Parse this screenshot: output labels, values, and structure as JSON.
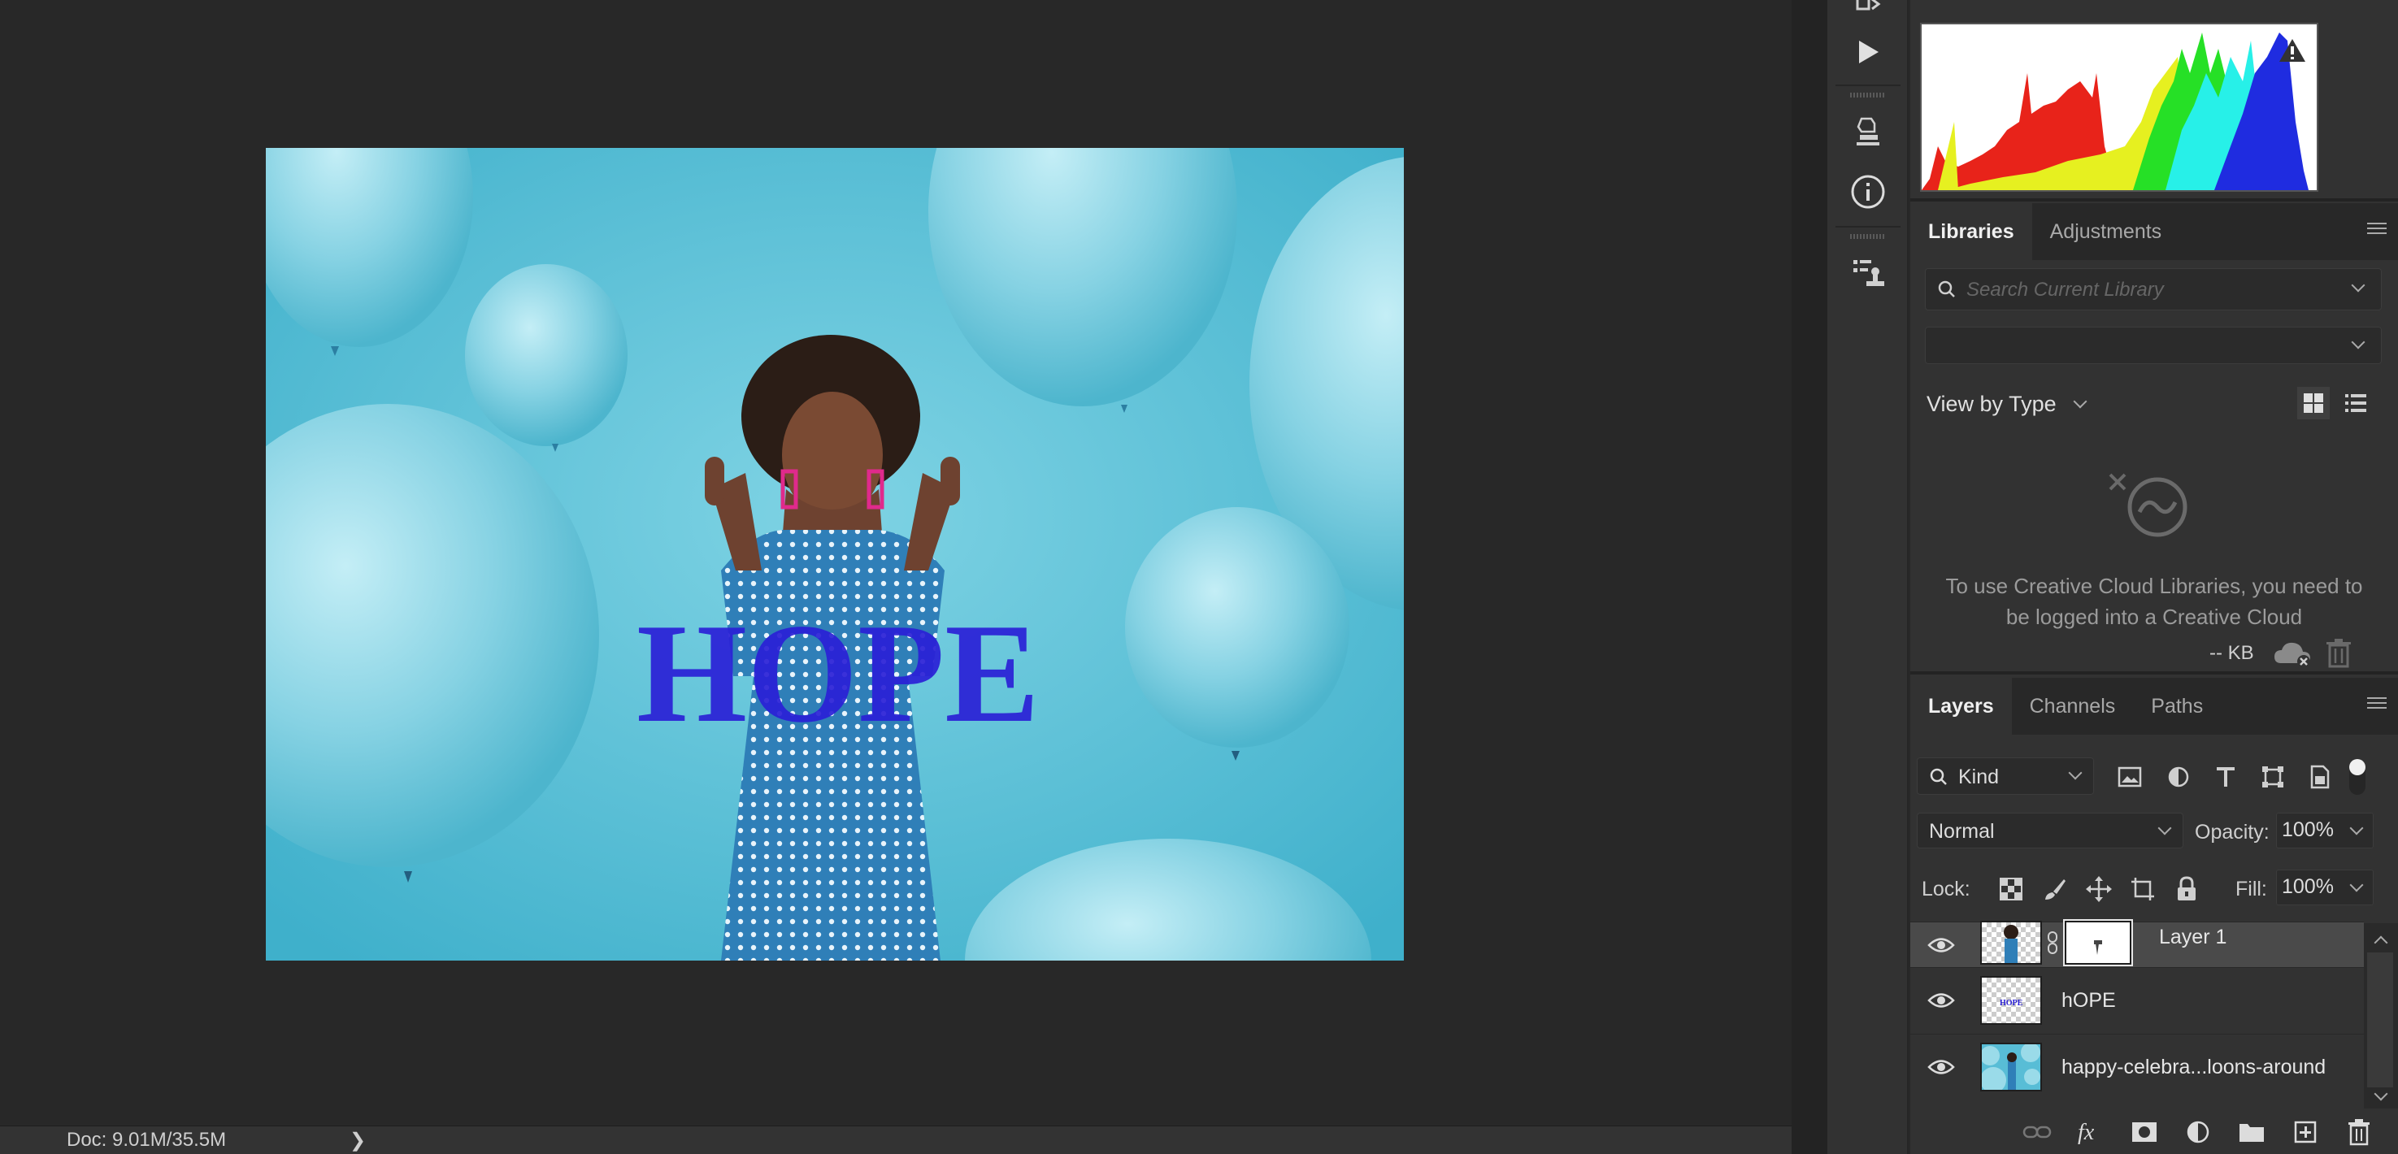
{
  "status": {
    "doc_info": "Doc: 9.01M/35.5M",
    "arrow": "❯"
  },
  "canvas": {
    "overlay_text": "HOPE",
    "overlay_color": "#2a1fd6"
  },
  "libraries": {
    "tabs": [
      "Libraries",
      "Adjustments"
    ],
    "search_placeholder": "Search Current Library",
    "view_by_label": "View by Type",
    "empty_message": "To use Creative Cloud Libraries, you need to be logged into a Creative Cloud",
    "storage_label": "-- KB"
  },
  "layers": {
    "tabs": [
      "Layers",
      "Channels",
      "Paths"
    ],
    "kind_label": "Kind",
    "blend_mode": "Normal",
    "opacity_label": "Opacity:",
    "opacity_value": "100%",
    "lock_label": "Lock:",
    "fill_label": "Fill:",
    "fill_value": "100%",
    "items": [
      {
        "name": "Layer 1",
        "selected": true
      },
      {
        "name": "hOPE",
        "selected": false
      },
      {
        "name": "happy-celebra...loons-around",
        "selected": false
      }
    ]
  },
  "icons": {
    "tool_strip": [
      "play-icon",
      "3d-material-icon",
      "info-icon",
      "clone-source-icon"
    ],
    "layers_footer": [
      "link-icon",
      "fx-icon",
      "mask-icon",
      "adjustment-icon",
      "folder-icon",
      "new-layer-icon",
      "trash-icon"
    ]
  },
  "colors": {
    "canvas_bg": "#282828",
    "panel_bg": "#323232",
    "image_bg": "#5ec2d8"
  }
}
